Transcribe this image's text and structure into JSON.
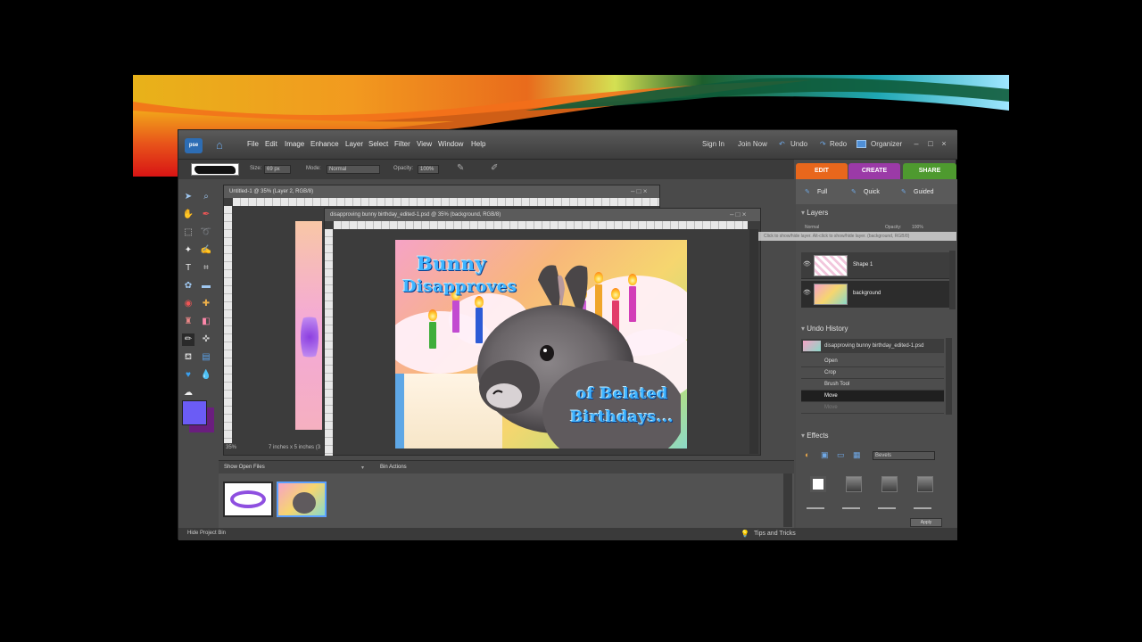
{
  "app": {
    "logo_label": "pse",
    "menu": [
      "File",
      "Edit",
      "Image",
      "Enhance",
      "Layer",
      "Select",
      "Filter",
      "View",
      "Window",
      "Help"
    ],
    "sign_in": "Sign In",
    "join_now": "Join Now",
    "undo": "Undo",
    "redo": "Redo",
    "organizer": "Organizer"
  },
  "options_bar": {
    "size_label": "Size:",
    "size_value": "69 px",
    "mode_label": "Mode:",
    "mode_value": "Normal",
    "opacity_label": "Opacity:",
    "opacity_value": "100%"
  },
  "mode_tabs": {
    "edit": "EDIT",
    "create": "CREATE",
    "share": "SHARE"
  },
  "edit_tabs": {
    "full": "Full",
    "quick": "Quick",
    "guided": "Guided"
  },
  "colors": {
    "edit_tab": "#e8671c",
    "create_tab": "#9b3aa7",
    "share_tab": "#4e9a2f",
    "foreground": "#6b5cf5",
    "background": "#6a1e7e",
    "title_text": "#3fb4ff"
  },
  "doc_back": {
    "title": "Untitled-1 @ 35% (Layer 2, RGB/8)",
    "zoom": "35%",
    "size": "7 inches x 5 inches (3"
  },
  "doc_front": {
    "title": "disapproving bunny birthday_edited-1.psd @ 35% (background, RGB/8)",
    "title_line1": "Bunny",
    "title_line2": "Disapproves",
    "subtitle_line1": "of Belated",
    "subtitle_line2": "Birthdays..."
  },
  "layers": {
    "heading": "Layers",
    "blend_mode": "Normal",
    "opacity_label": "Opacity:",
    "opacity_value": "100%",
    "tooltip": "Click to show/hide layer. Alt-click to show/hide layer. (background, RGB/8)",
    "rows": [
      "Shape 1",
      "background"
    ]
  },
  "undo_history": {
    "heading": "Undo History",
    "document": "disapproving bunny birthday_edited-1.psd",
    "steps": [
      "Open",
      "Crop",
      "Brush Tool",
      "Move",
      "Move"
    ]
  },
  "effects": {
    "heading": "Effects",
    "category": "Bevels",
    "apply": "Apply"
  },
  "bin": {
    "show_label": "Show Open Files",
    "actions": "Bin Actions"
  },
  "status": {
    "hide_bin": "Hide Project Bin",
    "tips": "Tips and Tricks"
  }
}
